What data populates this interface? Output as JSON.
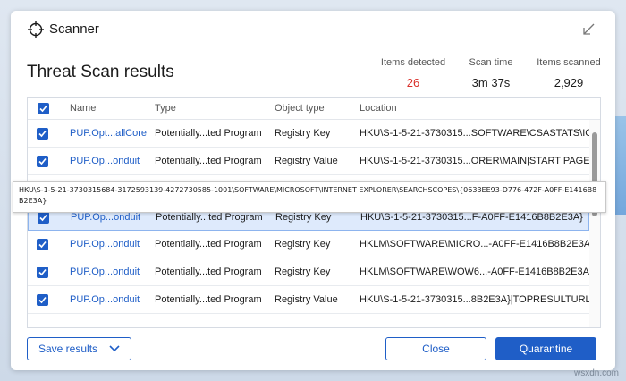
{
  "window": {
    "title": "Scanner"
  },
  "heading": "Threat Scan results",
  "stats": {
    "detected_label": "Items detected",
    "detected_value": "26",
    "time_label": "Scan time",
    "time_value": "3m 37s",
    "scanned_label": "Items scanned",
    "scanned_value": "2,929"
  },
  "table": {
    "columns": {
      "name": "Name",
      "type": "Type",
      "object_type": "Object type",
      "location": "Location"
    },
    "rows": [
      {
        "name": "PUP.Opt...allCore",
        "type": "Potentially...ted Program",
        "object_type": "Registry Key",
        "location": "HKU\\S-1-5-21-3730315...SOFTWARE\\CSASTATS\\IC",
        "checked": true,
        "selected": false
      },
      {
        "name": "PUP.Op...onduit",
        "type": "Potentially...ted Program",
        "object_type": "Registry Value",
        "location": "HKU\\S-1-5-21-3730315...ORER\\MAIN|START PAGE",
        "checked": true,
        "selected": false
      },
      {
        "name": "",
        "type": "",
        "object_type": "",
        "location": "",
        "checked": true,
        "selected": false
      },
      {
        "name": "PUP.Op...onduit",
        "type": "Potentially...ted Program",
        "object_type": "Registry Key",
        "location": "HKU\\S-1-5-21-3730315...F-A0FF-E1416B8B2E3A}",
        "checked": true,
        "selected": true
      },
      {
        "name": "PUP.Op...onduit",
        "type": "Potentially...ted Program",
        "object_type": "Registry Key",
        "location": "HKLM\\SOFTWARE\\MICRO...-A0FF-E1416B8B2E3A}",
        "checked": true,
        "selected": false
      },
      {
        "name": "PUP.Op...onduit",
        "type": "Potentially...ted Program",
        "object_type": "Registry Key",
        "location": "HKLM\\SOFTWARE\\WOW6...-A0FF-E1416B8B2E3A}",
        "checked": true,
        "selected": false
      },
      {
        "name": "PUP.Op...onduit",
        "type": "Potentially...ted Program",
        "object_type": "Registry Value",
        "location": "HKU\\S-1-5-21-3730315...8B2E3A}|TOPRESULTURL",
        "checked": true,
        "selected": false
      }
    ]
  },
  "tooltip": "HKU\\S-1-5-21-3730315684-3172593139-4272730585-1001\\SOFTWARE\\MICROSOFT\\INTERNET EXPLORER\\SEARCHSCOPES\\{0633EE93-D776-472F-A0FF-E1416B8B2E3A}",
  "buttons": {
    "save": "Save results",
    "close": "Close",
    "quarantine": "Quarantine"
  },
  "watermark": "wsxdn.com",
  "colors": {
    "accent": "#1f5ec7",
    "alert": "#d9302a",
    "selected_row": "#deeafc"
  },
  "icons": {
    "app": "crosshair-icon",
    "restore": "restore-arrow-icon",
    "check": "checkmark-icon",
    "caret": "chevron-down-icon"
  }
}
